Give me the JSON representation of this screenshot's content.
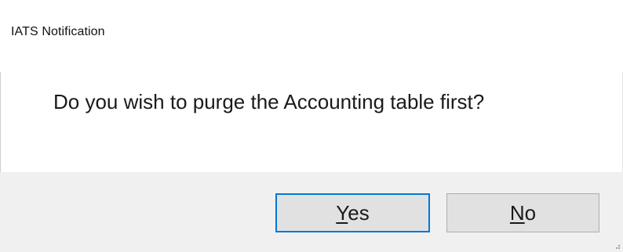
{
  "window": {
    "title": "IATS Notification"
  },
  "message": {
    "text": "Do you wish to purge the Accounting table first?"
  },
  "buttons": {
    "yes": {
      "label": "Yes",
      "access_key": "Y",
      "rest": "es",
      "default": true
    },
    "no": {
      "label": "No",
      "access_key": "N",
      "rest": "o",
      "default": false
    }
  },
  "colors": {
    "focus_border": "#0078d7",
    "footer_background": "#f0f0f0",
    "button_face": "#e1e1e1"
  },
  "icons": {
    "resize_grip": "size-grip-icon"
  }
}
